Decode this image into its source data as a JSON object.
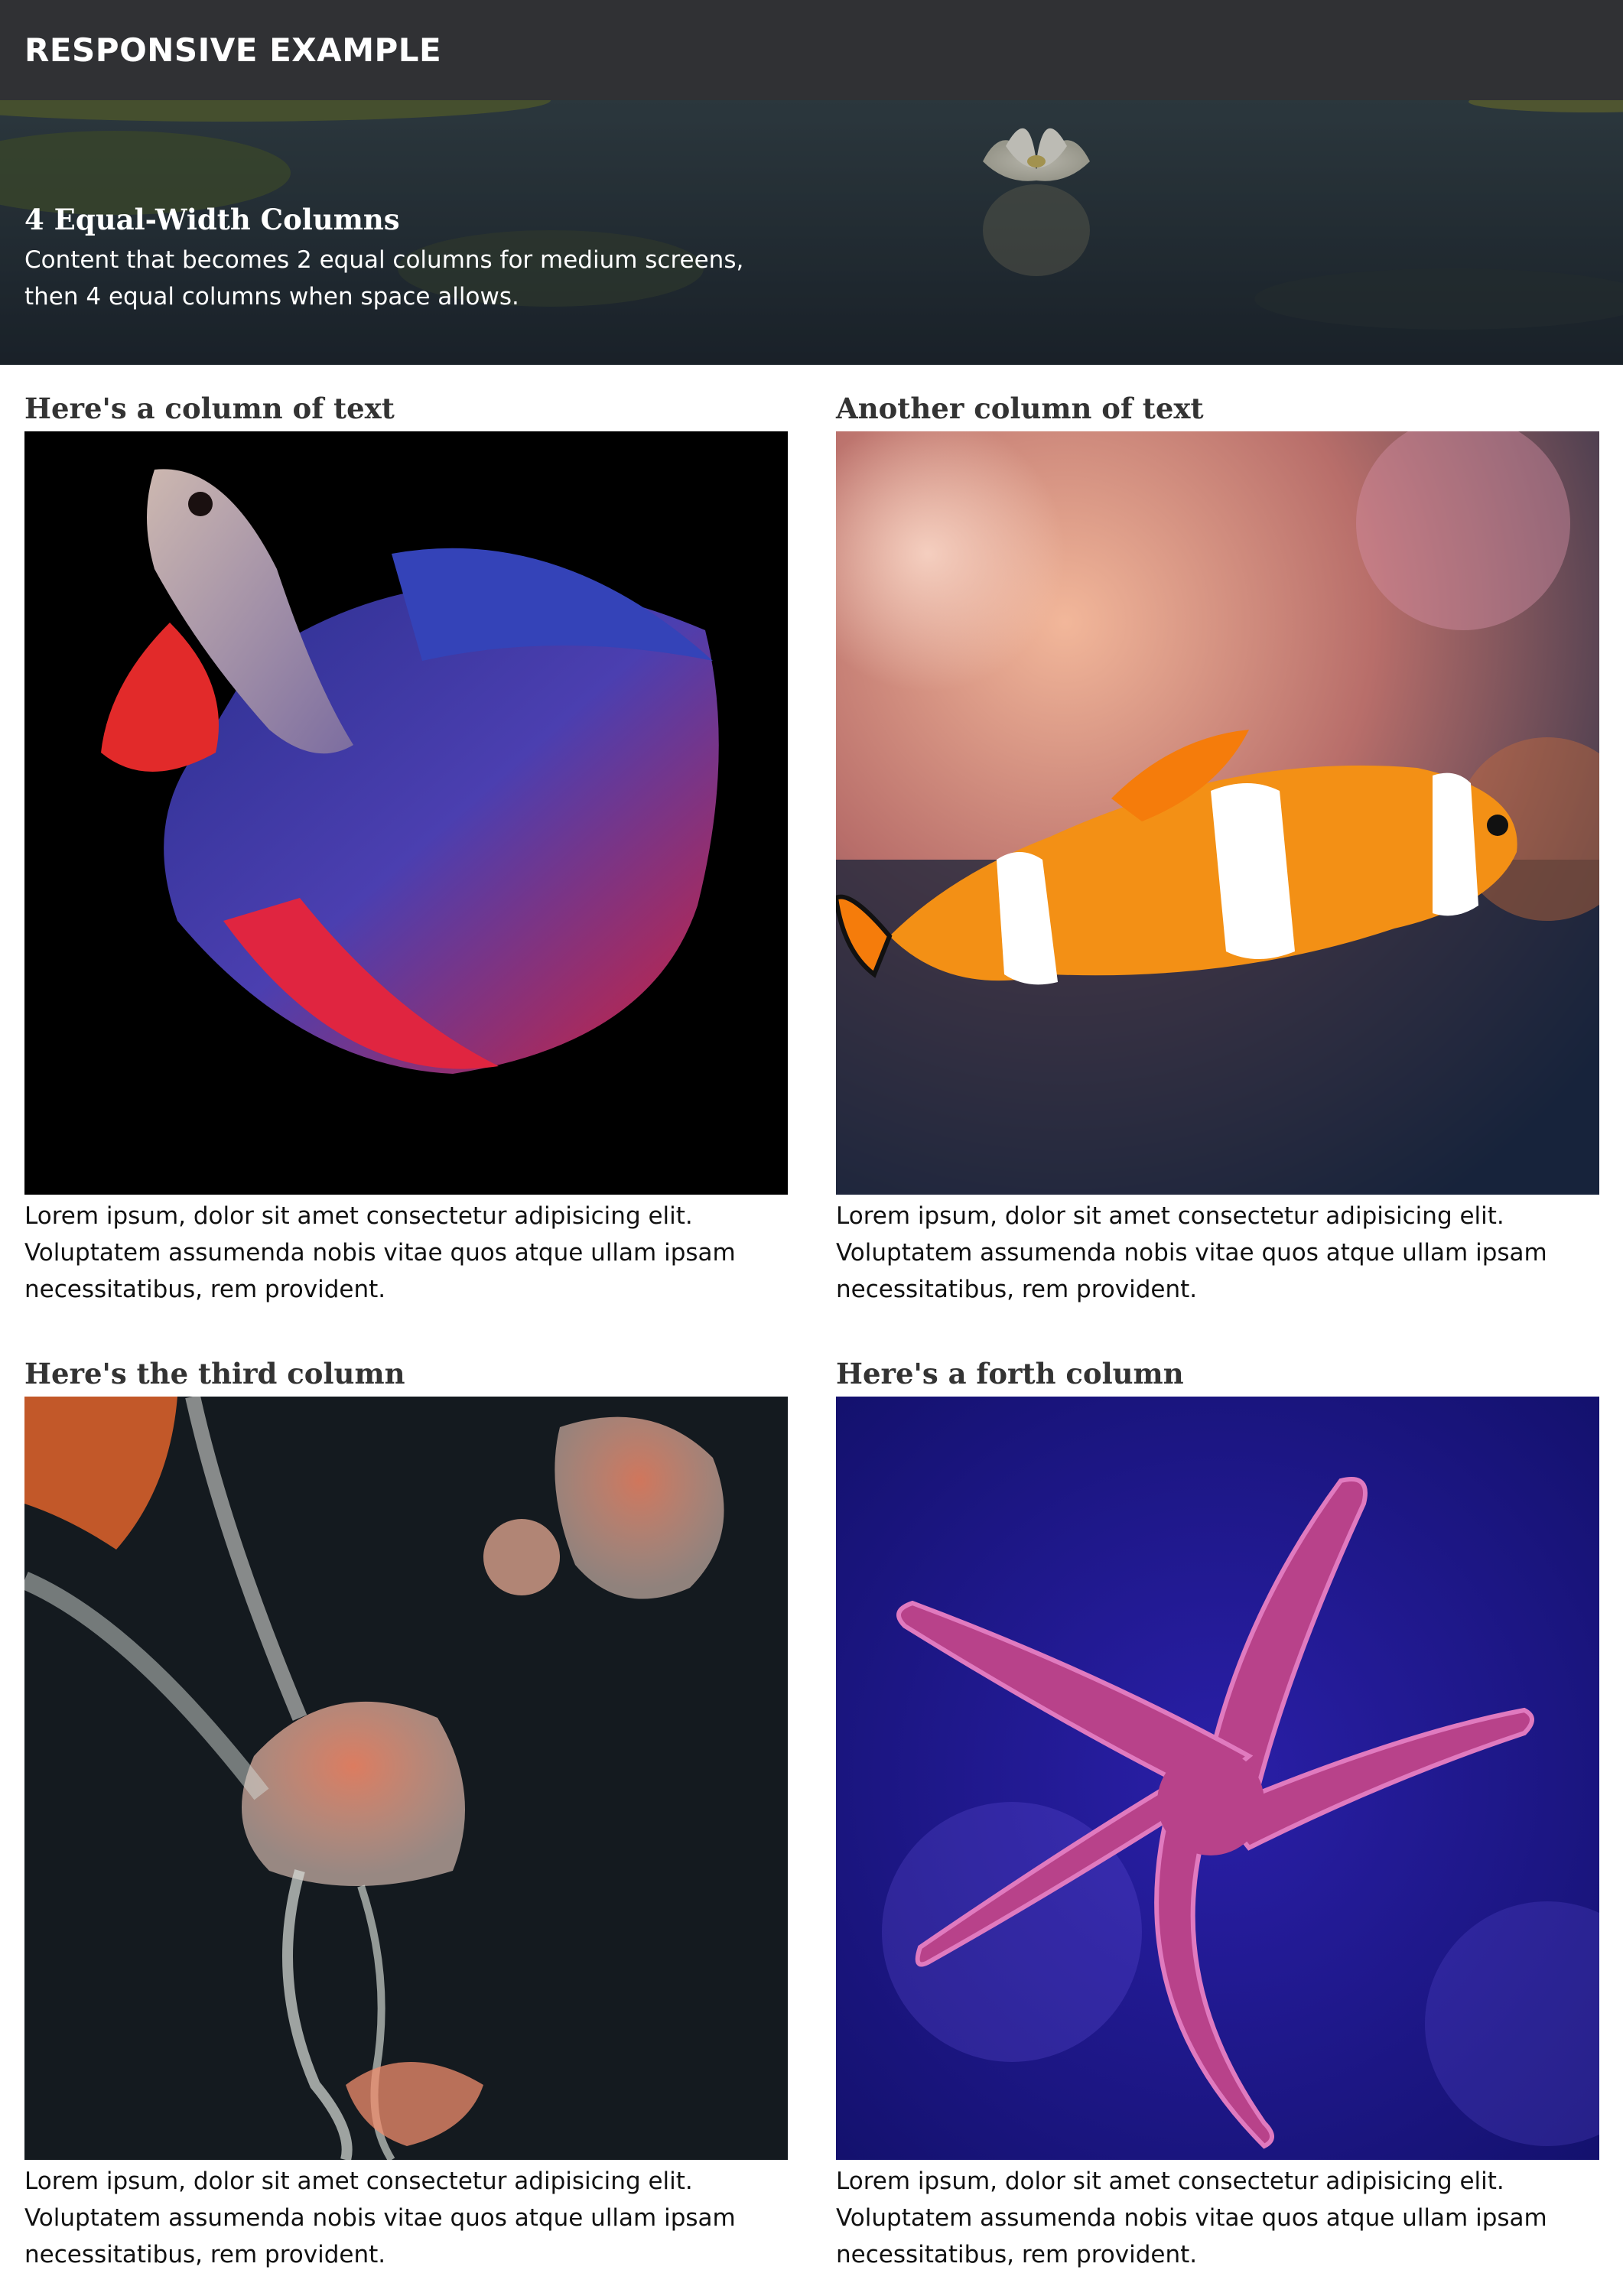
{
  "header": {
    "brand": "RESPONSIVE EXAMPLE"
  },
  "hero": {
    "title": "4 Equal-Width Columns",
    "description": "Content that becomes 2 equal columns for medium screens, then 4 equal columns when space allows."
  },
  "columns": [
    {
      "title": "Here's a column of text",
      "text": "Lorem ipsum, dolor sit amet consectetur adipisicing elit. Voluptatem assumenda nobis vitae quos atque ullam ipsam necessitatibus, rem provident."
    },
    {
      "title": "Another column of text",
      "text": "Lorem ipsum, dolor sit amet consectetur adipisicing elit. Voluptatem assumenda nobis vitae quos atque ullam ipsam necessitatibus, rem provident."
    },
    {
      "title": "Here's the third column",
      "text": "Lorem ipsum, dolor sit amet consectetur adipisicing elit. Voluptatem assumenda nobis vitae quos atque ullam ipsam necessitatibus, rem provident."
    },
    {
      "title": "Here's a forth column",
      "text": "Lorem ipsum, dolor sit amet consectetur adipisicing elit. Voluptatem assumenda nobis vitae quos atque ullam ipsam necessitatibus, rem provident."
    }
  ],
  "colors": {
    "header_bg": "#303134",
    "hero_water": "#2d3a44",
    "text": "#111111",
    "heading": "#333333"
  }
}
